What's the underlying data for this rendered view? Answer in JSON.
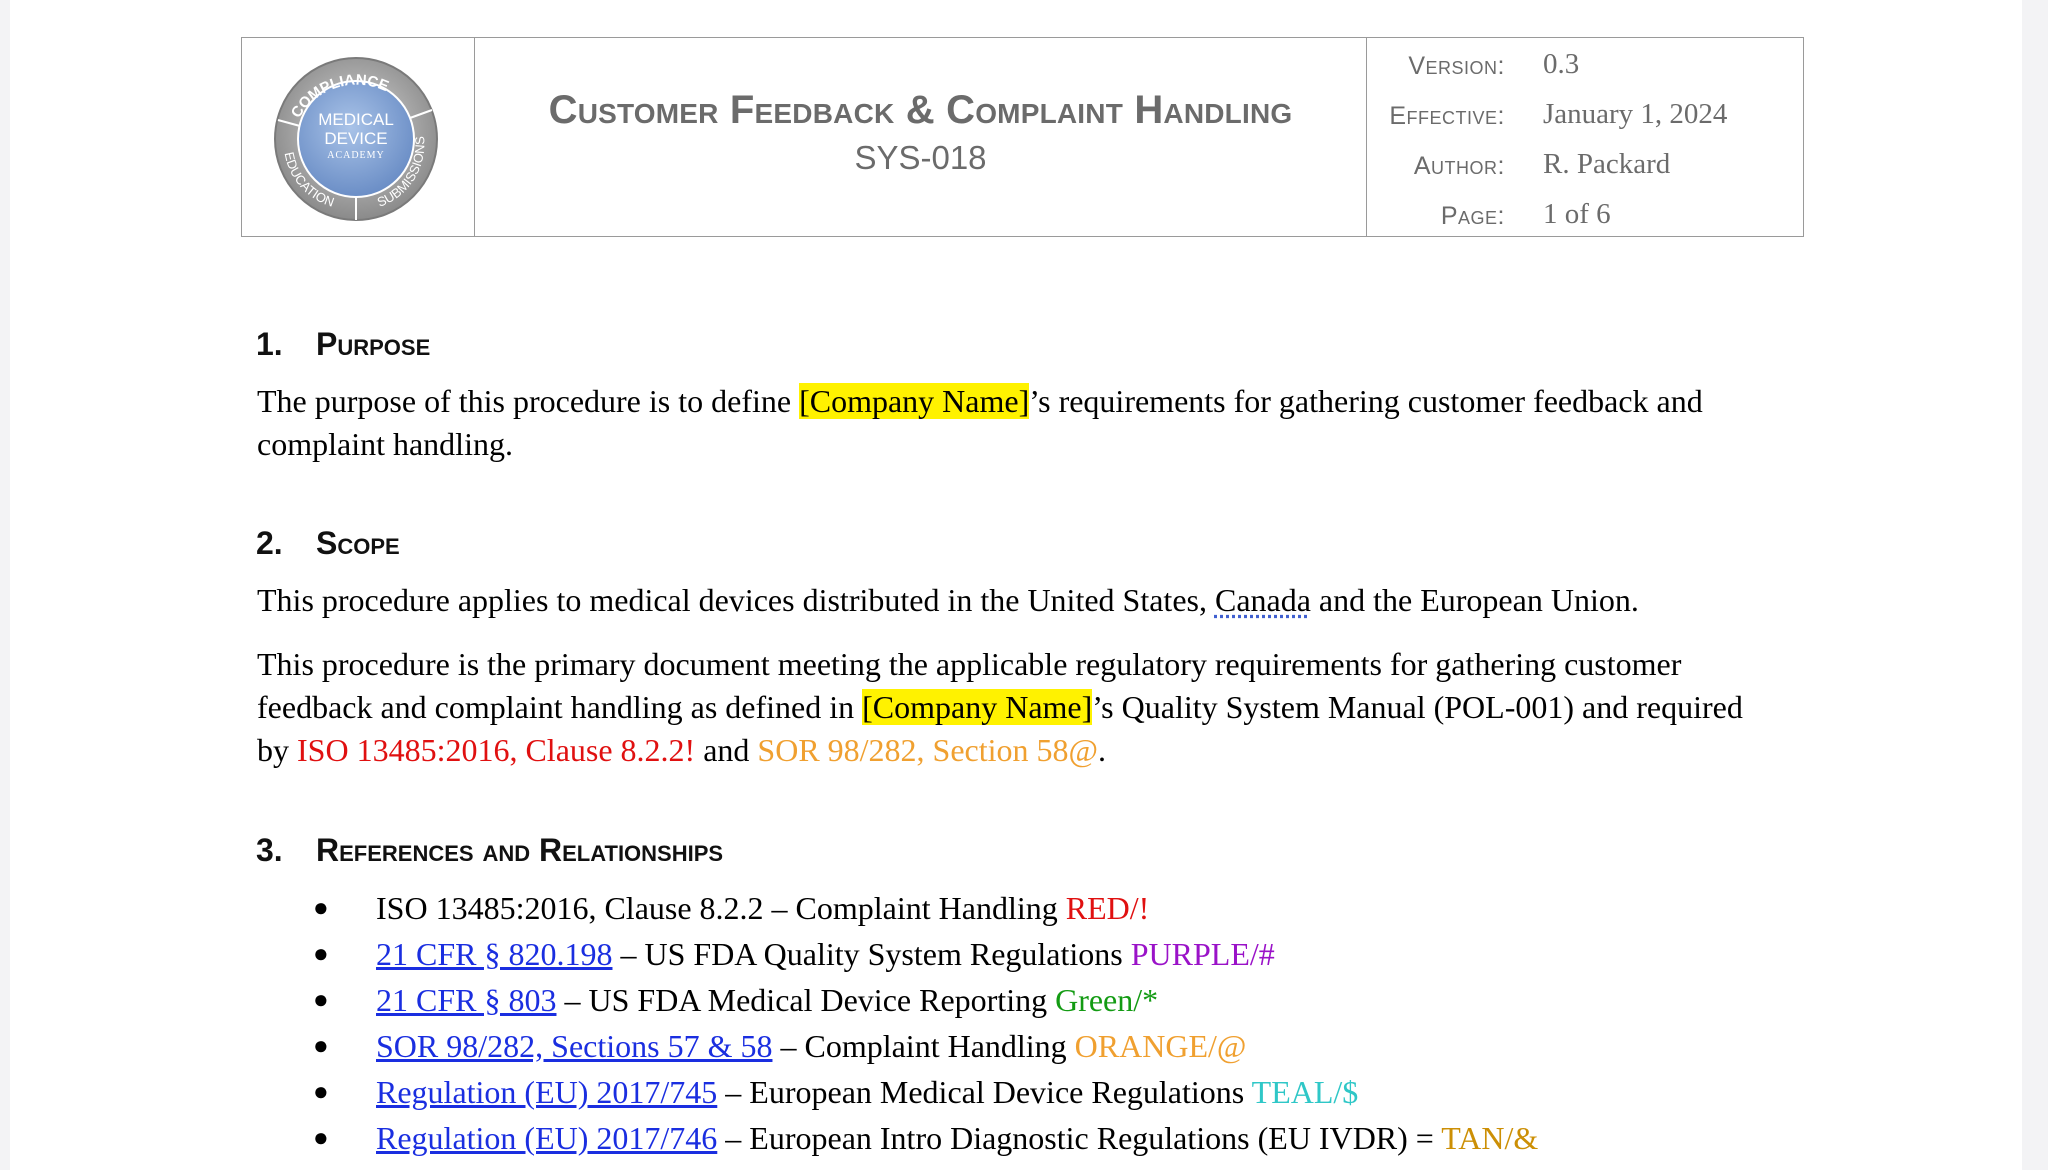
{
  "header": {
    "logo": {
      "arc_top": "COMPLIANCE",
      "arc_left": "EDUCATION",
      "arc_right": "SUBMISSIONS",
      "center_line1": "MEDICAL",
      "center_line2": "DEVICE",
      "center_line3": "ACADEMY"
    },
    "title": "Customer Feedback & Complaint Handling",
    "doc_code": "SYS-018",
    "meta": [
      {
        "label": "Version:",
        "value": "0.3"
      },
      {
        "label": "Effective:",
        "value": "January 1, 2024"
      },
      {
        "label": "Author:",
        "value": "R. Packard"
      },
      {
        "label": "Page:",
        "value": "1 of 6"
      }
    ]
  },
  "sections": {
    "purpose": {
      "number": "1.",
      "heading": "Purpose",
      "p1_a": "The purpose of this procedure is to define ",
      "p1_company": "[Company Name]",
      "p1_b": "’s requirements for gathering customer feedback and",
      "p1_c": "complaint handling."
    },
    "scope": {
      "number": "2.",
      "heading": "Scope",
      "p1_a": "This procedure applies to medical devices distributed in the United States, ",
      "p1_canada": "Canada",
      "p1_b": " and the European Union.",
      "p2_a": "This procedure is the primary document meeting the applicable regulatory requirements for gathering customer",
      "p2_b": "feedback and complaint handling as defined in ",
      "p2_company": "[Company Name]",
      "p2_c": "’s Quality System Manual (POL-001) and required",
      "p2_d": "by ",
      "p2_iso": "ISO 13485:2016, Clause 8.2.2!",
      "p2_and": " and ",
      "p2_sor": "SOR 98/282, Section 58@",
      "p2_end": "."
    },
    "references": {
      "number": "3.",
      "heading": "References and Relationships",
      "items": [
        {
          "link": "",
          "plain": "ISO 13485:2016, Clause 8.2.2 – Complaint Handling ",
          "tag": "RED/!"
        },
        {
          "link": "21 CFR § 820.198",
          "plain": " – US FDA Quality System Regulations ",
          "tag": "PURPLE/#"
        },
        {
          "link": "21 CFR § 803",
          "plain": " – US FDA Medical Device Reporting ",
          "tag": "Green/*"
        },
        {
          "link": "SOR 98/282, Sections 57 & 58",
          "plain": " – Complaint Handling ",
          "tag": "ORANGE/@"
        },
        {
          "link": "Regulation (EU) 2017/745",
          "plain": " – European Medical Device Regulations ",
          "tag": "TEAL/$"
        },
        {
          "link": "Regulation (EU) 2017/746",
          "plain": " – European Intro Diagnostic Regulations (EU IVDR) = ",
          "tag": "TAN/&"
        }
      ]
    }
  },
  "colors": {
    "highlight": "#fff200",
    "red": "#e01010",
    "orange": "#f0a030",
    "purple": "#9a12c8",
    "green": "#139b13",
    "teal": "#2fc7c7",
    "tan": "#cc8f05",
    "link": "#1a2ee0"
  }
}
